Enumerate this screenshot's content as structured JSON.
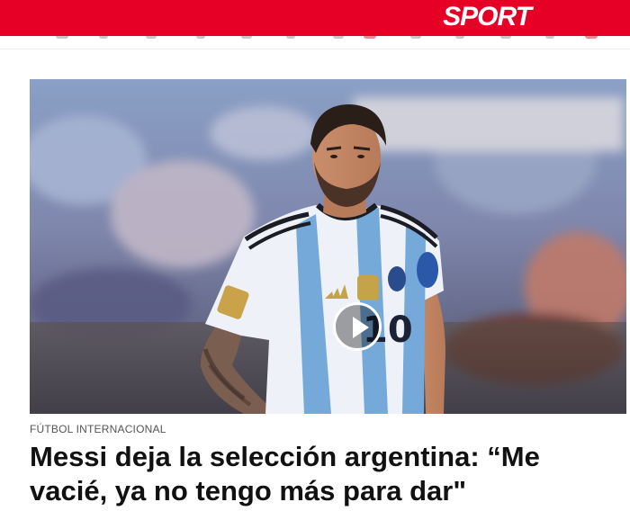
{
  "header": {
    "brand": "SPORT",
    "brand_color": "#e60026"
  },
  "hero": {
    "media_type": "video",
    "play_icon": "play-icon",
    "jersey_number": "10"
  },
  "article": {
    "section": "FÚTBOL INTERNACIONAL",
    "headline": "Messi deja la selección argentina: “Me vacié, ya no tengo más para dar\""
  }
}
